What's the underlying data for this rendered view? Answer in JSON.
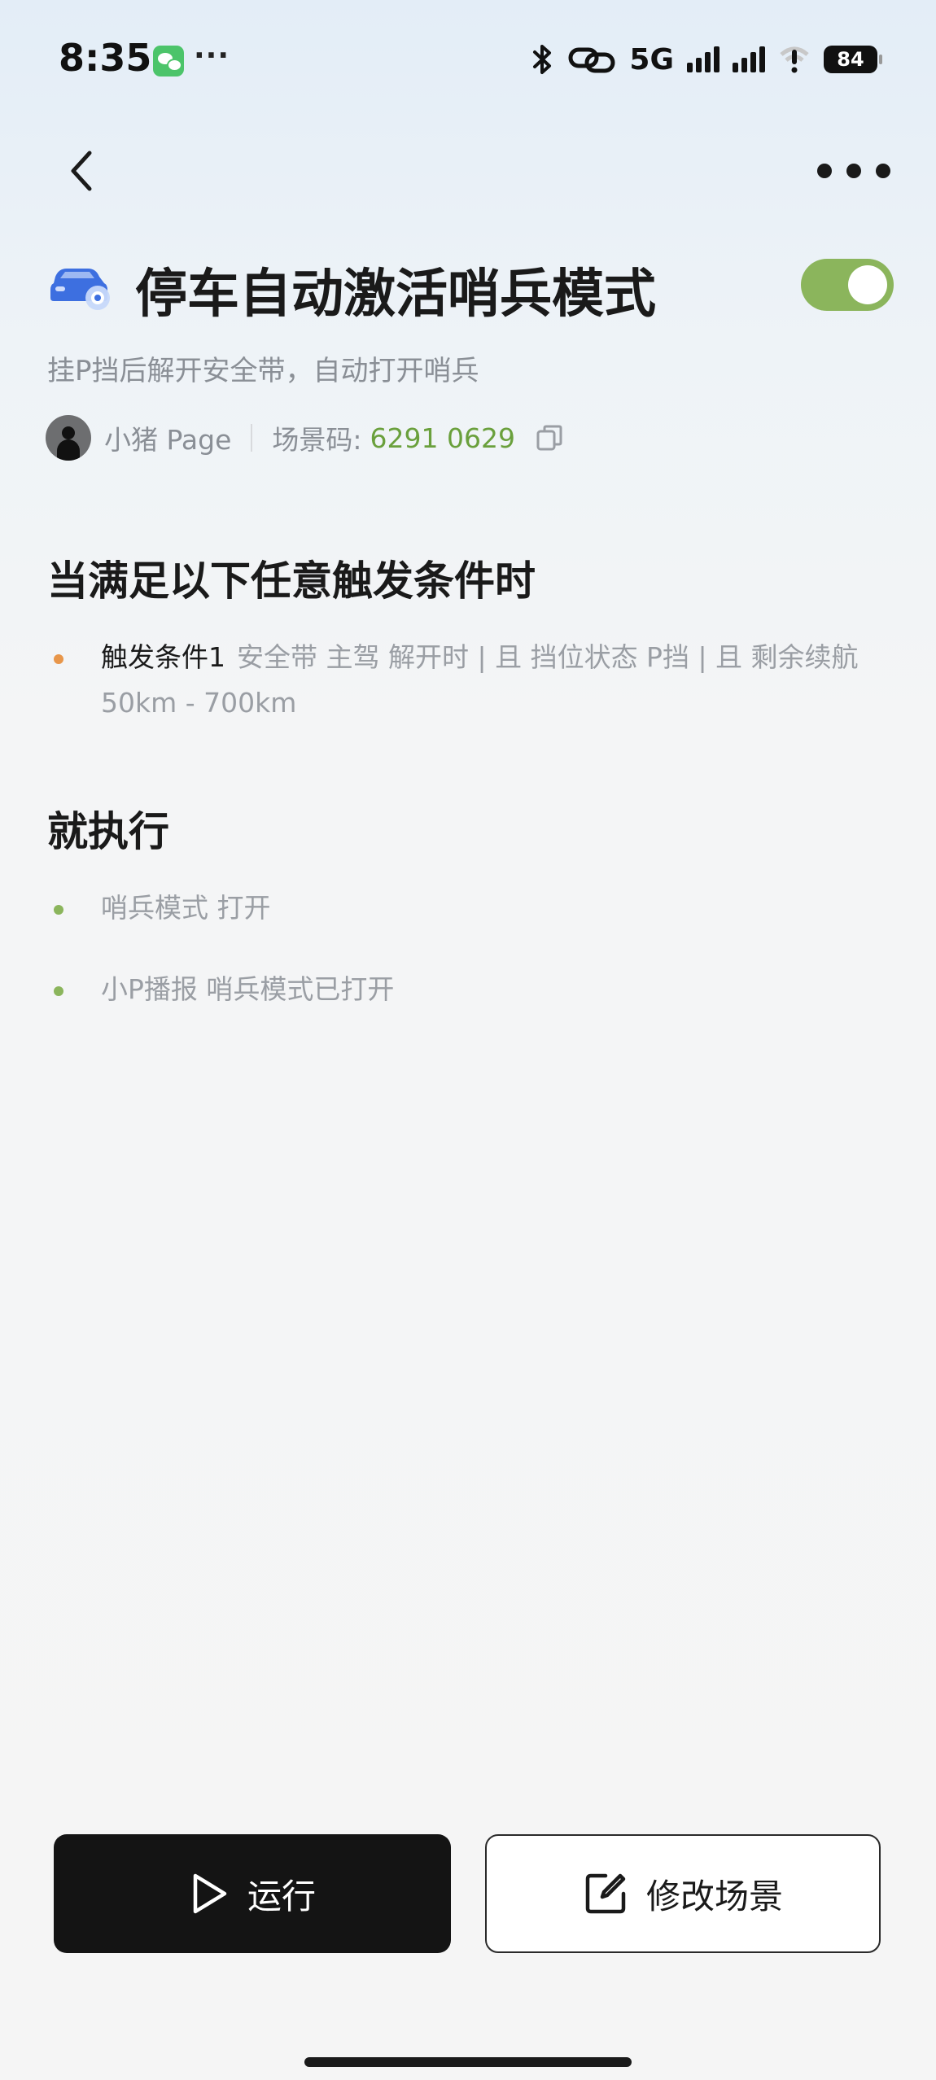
{
  "status_bar": {
    "time": "8:35",
    "more": "···",
    "network": "5G",
    "battery": "84"
  },
  "scene": {
    "title": "停车自动激活哨兵模式",
    "description": "挂P挡后解开安全带，自动打开哨兵",
    "enabled": true,
    "author": "小猪 Page",
    "code_label": "场景码:",
    "code_value": "6291 0629"
  },
  "conditions": {
    "heading": "当满足以下任意触发条件时",
    "items": [
      {
        "label": "触发条件1",
        "text": "安全带 主驾 解开时 | 且 挡位状态 P挡 | 且 剩余续航 50km - 700km"
      }
    ]
  },
  "actions": {
    "heading": "就执行",
    "items": [
      {
        "text": "哨兵模式 打开"
      },
      {
        "text": "小P播报 哨兵模式已打开"
      }
    ]
  },
  "buttons": {
    "run": "运行",
    "edit": "修改场景"
  },
  "colors": {
    "accent_green": "#8bb55c",
    "code_green": "#6aa03c",
    "condition_bullet": "#e8964a",
    "action_bullet": "#8bb55c",
    "car_icon_blue": "#3d6fe0"
  }
}
